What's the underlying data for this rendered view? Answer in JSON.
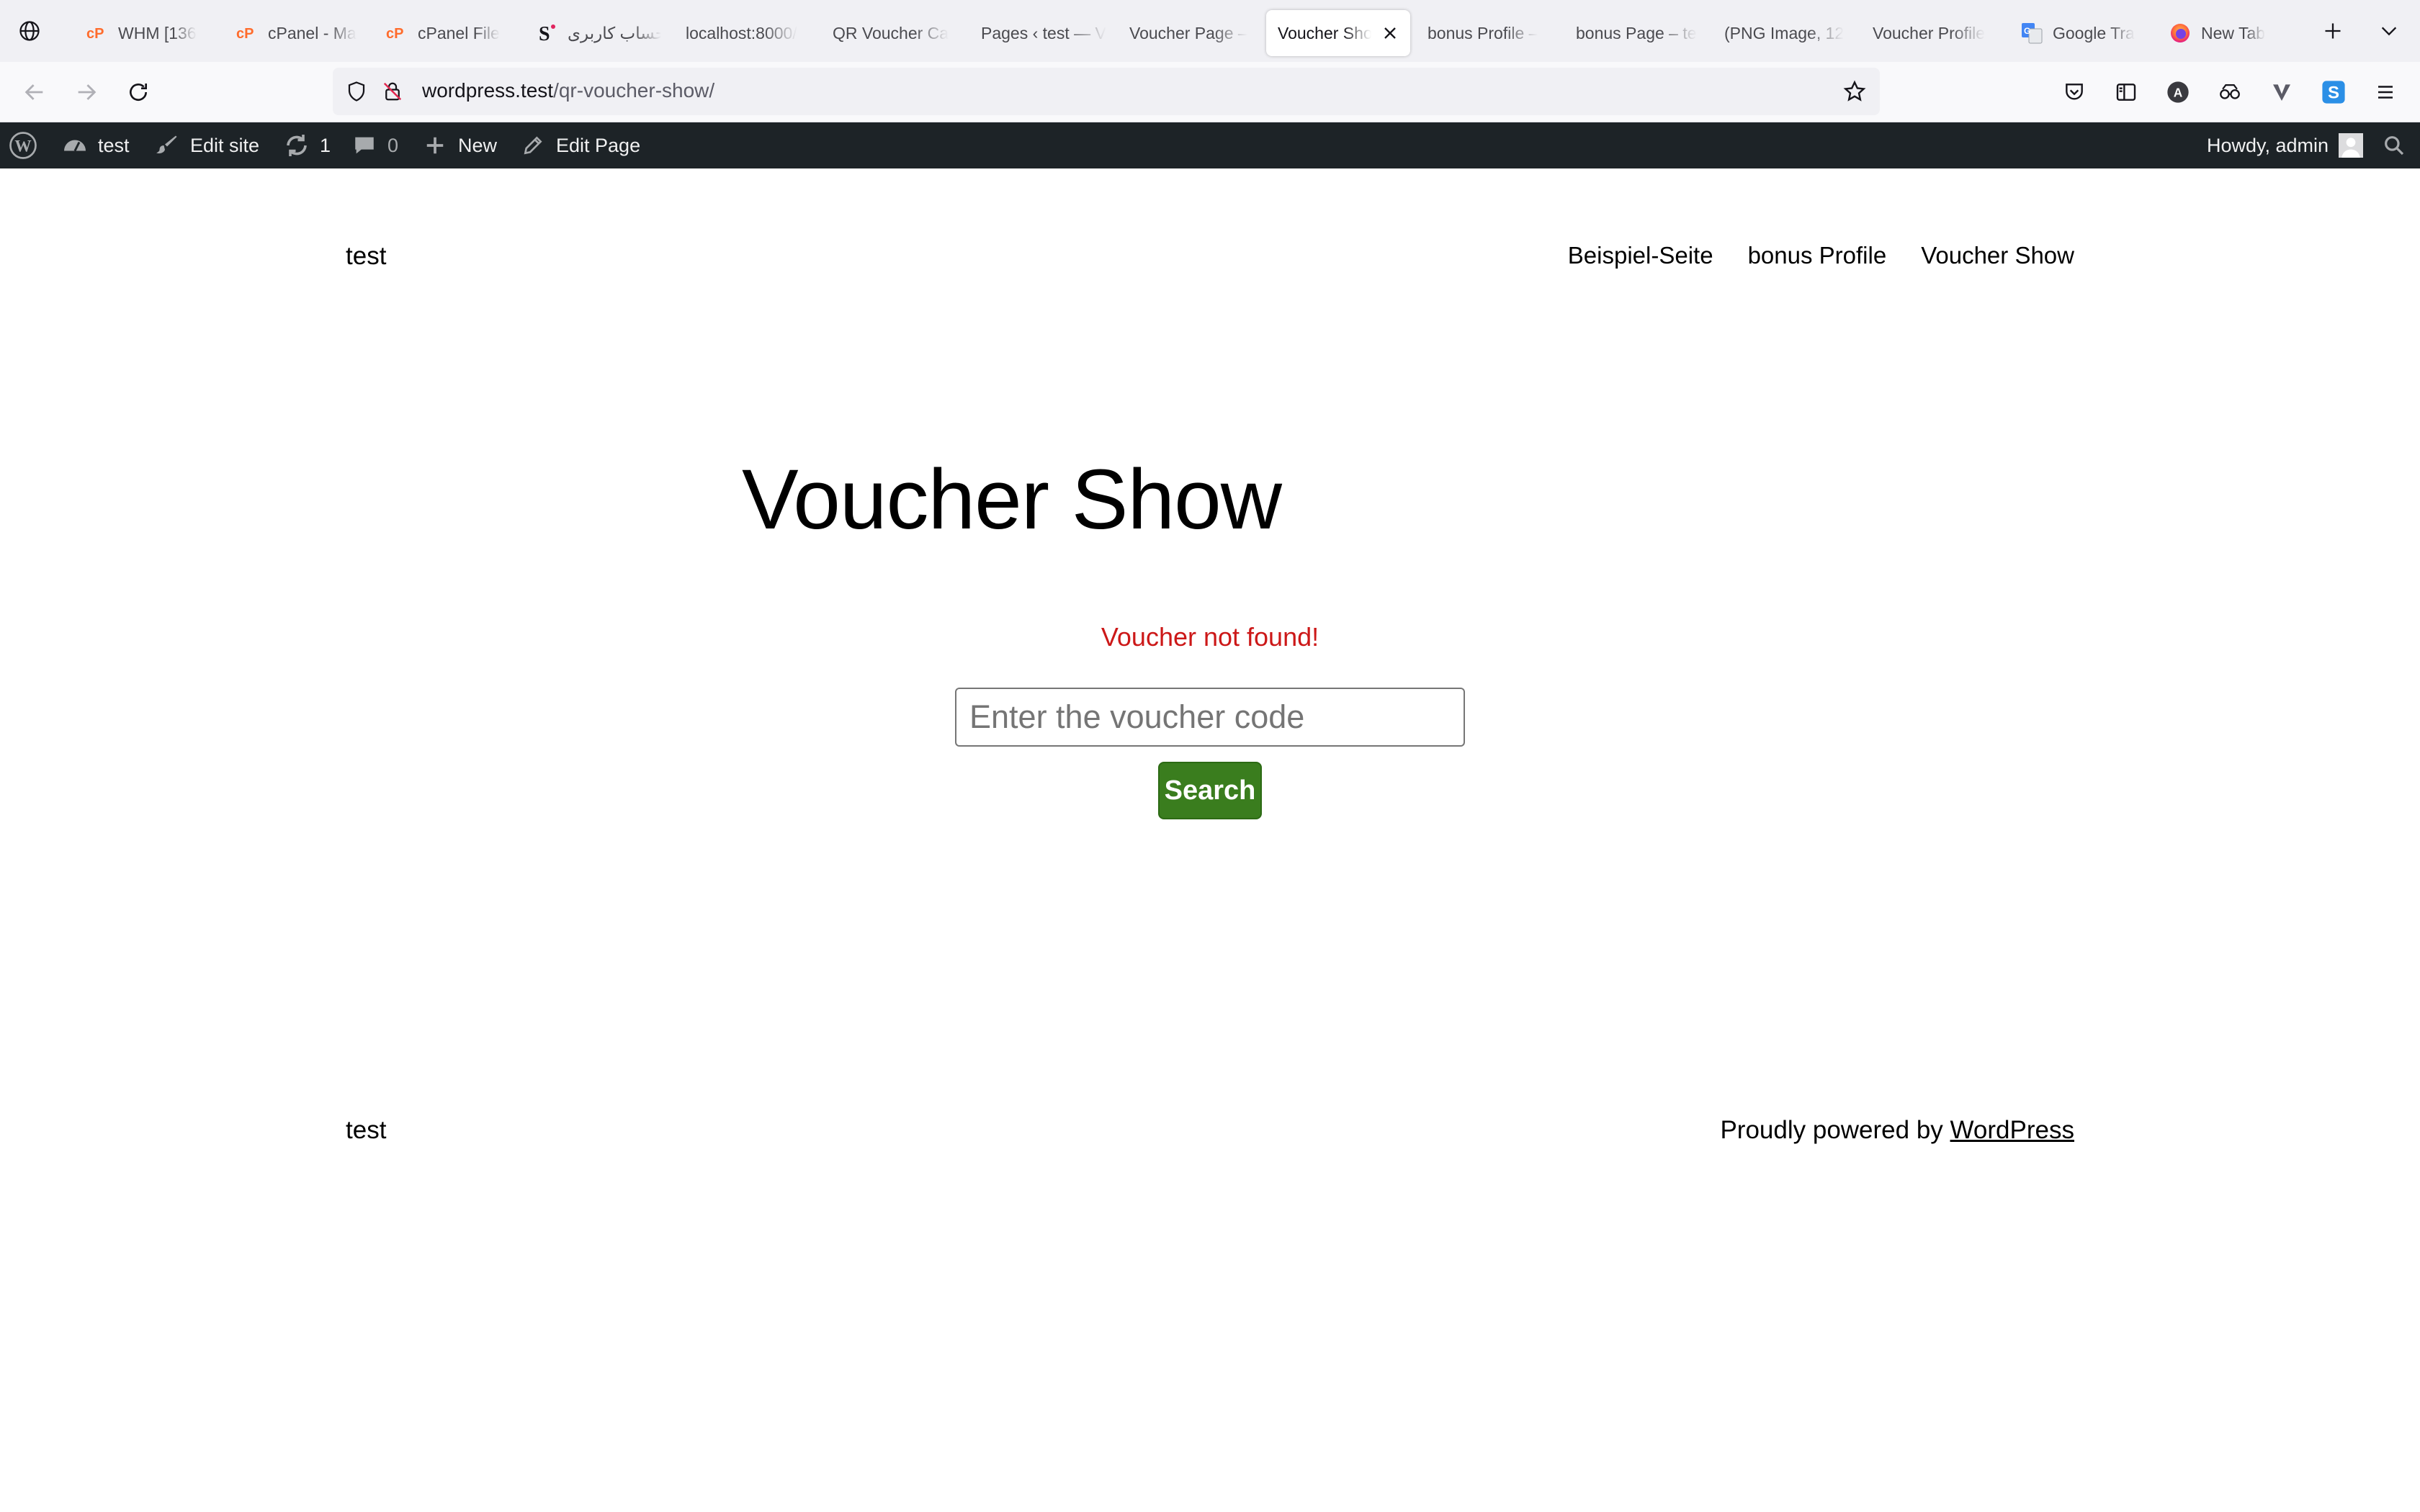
{
  "browser": {
    "tabs": [
      {
        "label": "WHM [136",
        "icon": "cpanel-icon"
      },
      {
        "label": "cPanel - Ma",
        "icon": "cpanel-icon"
      },
      {
        "label": "cPanel File",
        "icon": "cpanel-icon"
      },
      {
        "label": "حساب کاربری",
        "icon": "s-logo-icon"
      },
      {
        "label": "localhost:8000/",
        "icon": ""
      },
      {
        "label": "QR Voucher Ca",
        "icon": ""
      },
      {
        "label": "Pages ‹ test — V",
        "icon": ""
      },
      {
        "label": "Voucher Page –",
        "icon": ""
      },
      {
        "label": "Voucher Sho",
        "icon": "",
        "active": true
      },
      {
        "label": "bonus Profile –",
        "icon": ""
      },
      {
        "label": "bonus Page – te",
        "icon": ""
      },
      {
        "label": "(PNG Image, 12",
        "icon": ""
      },
      {
        "label": "Voucher Profile",
        "icon": ""
      },
      {
        "label": "Google Tra",
        "icon": "google-translate-icon"
      },
      {
        "label": "New Tab",
        "icon": "firefox-icon"
      }
    ],
    "url_domain": "wordpress.test",
    "url_path": "/qr-voucher-show/"
  },
  "adminbar": {
    "site_name": "test",
    "edit_site": "Edit site",
    "updates_count": "1",
    "comments_count": "0",
    "new_label": "New",
    "edit_page": "Edit Page",
    "greeting": "Howdy, admin"
  },
  "site": {
    "title": "test",
    "nav": [
      "Beispiel-Seite",
      "bonus Profile",
      "Voucher Show"
    ]
  },
  "page": {
    "title": "Voucher Show",
    "error": "Voucher not found!",
    "input_placeholder": "Enter the voucher code",
    "search_label": "Search"
  },
  "footer": {
    "title": "test",
    "credit_prefix": "Proudly powered by ",
    "credit_link": "WordPress"
  },
  "colors": {
    "admin_bar": "#1d2327",
    "error": "#cc1818",
    "button": "#3a7d1e"
  }
}
